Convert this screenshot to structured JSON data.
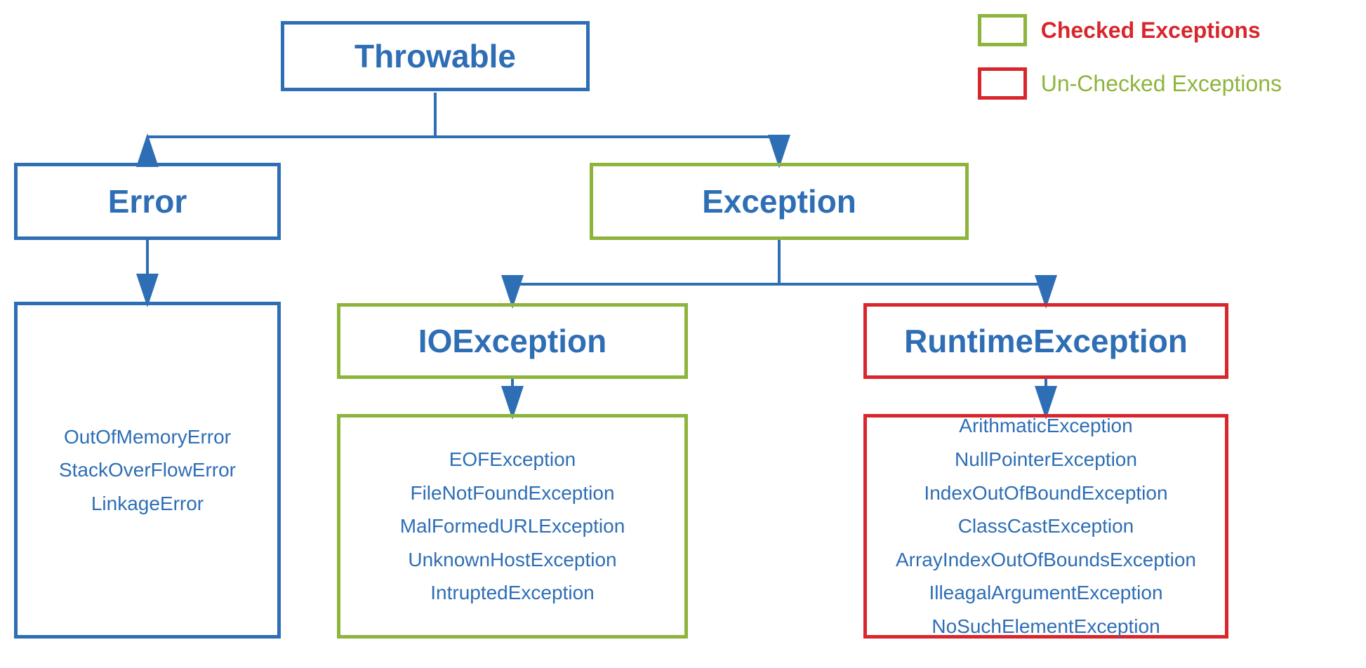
{
  "legend": {
    "checked_label": "Checked Exceptions",
    "unchecked_label": "Un-Checked Exceptions"
  },
  "nodes": {
    "throwable": {
      "label": "Throwable"
    },
    "error": {
      "label": "Error"
    },
    "exception": {
      "label": "Exception"
    },
    "ioexception": {
      "label": "IOException"
    },
    "runtimeexception": {
      "label": "RuntimeException"
    },
    "error_children": {
      "items": [
        "OutOfMemoryError",
        "StackOverFlowError",
        "LinkageError"
      ]
    },
    "ioexception_children": {
      "items": [
        "EOFException",
        "FileNotFoundException",
        "MalFormedURLException",
        "UnknownHostException",
        "IntruptedException"
      ]
    },
    "runtime_children": {
      "items": [
        "ArithmaticException",
        "NullPointerException",
        "IndexOutOfBoundException",
        "ClassCastException",
        "ArrayIndexOutOfBoundsException",
        "IlleagalArgumentException",
        "NoSuchElementException"
      ]
    }
  }
}
